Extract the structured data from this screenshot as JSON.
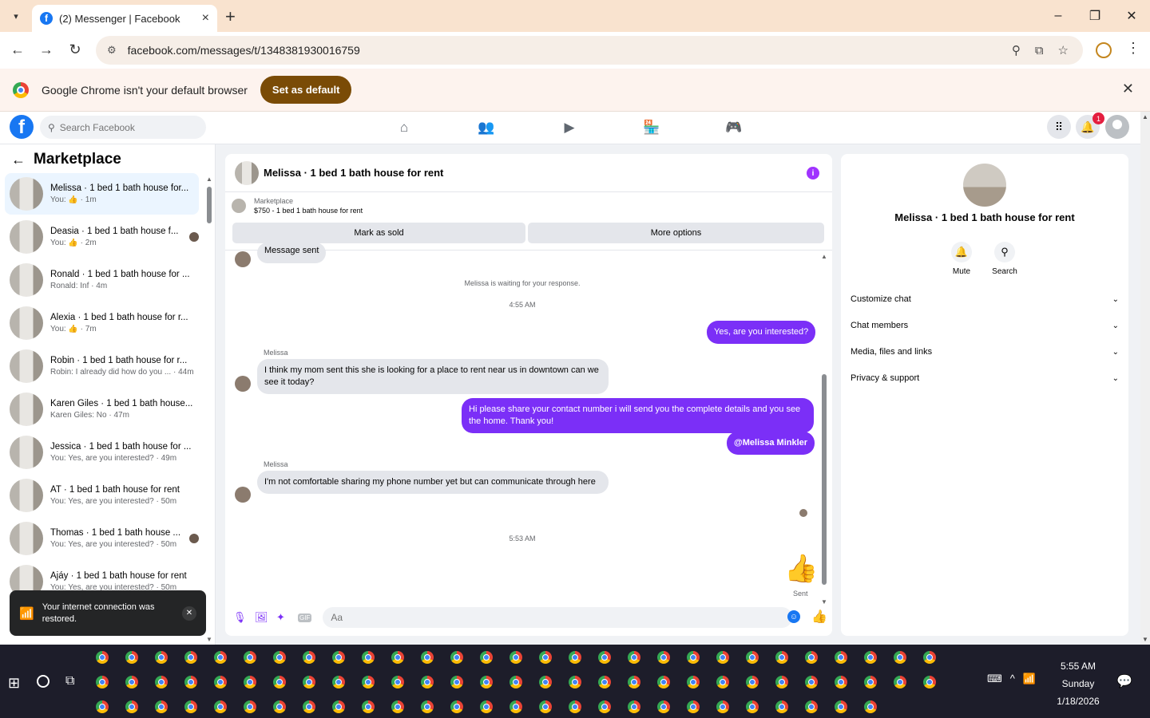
{
  "browser": {
    "tab_title": "(2) Messenger | Facebook",
    "url": "facebook.com/messages/t/1348381930016759",
    "infobar_message": "Google Chrome isn't your default browser",
    "infobar_button": "Set as default"
  },
  "fb": {
    "search_placeholder": "Search Facebook",
    "notification_count": "1"
  },
  "sidebar": {
    "title": "Marketplace",
    "conversations": [
      {
        "name": "Melissa · 1 bed 1 bath house for...",
        "sub": "You: 👍 · 1m",
        "active": true,
        "seen": false
      },
      {
        "name": "Deasia · 1 bed 1 bath house f...",
        "sub": "You: 👍 · 2m",
        "active": false,
        "seen": true
      },
      {
        "name": "Ronald · 1 bed 1 bath house for ...",
        "sub": "Ronald: Inf · 4m",
        "active": false,
        "seen": false
      },
      {
        "name": "Alexia · 1 bed 1 bath house for r...",
        "sub": "You: 👍 · 7m",
        "active": false,
        "seen": false
      },
      {
        "name": "Robin · 1 bed 1 bath house for r...",
        "sub": "Robin: I already did how do you ... · 44m",
        "active": false,
        "seen": false
      },
      {
        "name": "Karen Giles · 1 bed 1 bath house...",
        "sub": "Karen Giles: No · 47m",
        "active": false,
        "seen": false
      },
      {
        "name": "Jessica · 1 bed 1 bath house for ...",
        "sub": "You: Yes, are you interested? · 49m",
        "active": false,
        "seen": false
      },
      {
        "name": "AT · 1 bed 1 bath house for rent",
        "sub": "You: Yes, are you interested? · 50m",
        "active": false,
        "seen": false
      },
      {
        "name": "Thomas · 1 bed 1 bath house ...",
        "sub": "You: Yes, are you interested? · 50m",
        "active": false,
        "seen": true
      },
      {
        "name": "Ajáy · 1 bed 1 bath house for rent",
        "sub": "You: Yes, are you interested? · 50m",
        "active": false,
        "seen": false
      }
    ]
  },
  "toast": {
    "message": "Your internet connection was restored."
  },
  "chat": {
    "title": "Melissa · 1 bed 1 bath house for rent",
    "listing_source": "Marketplace",
    "listing_detail": "$750 - 1 bed 1 bath house for rent",
    "mark_sold": "Mark as sold",
    "more_options": "More options",
    "clipped_message": "Message sent",
    "waiting_notice": "Melissa is waiting for your response.",
    "time1": "4:55 AM",
    "out1": "Yes, are you interested?",
    "sender": "Melissa",
    "in1": "I think my mom sent this she is looking for a place to rent near us in downtown can we see it today?",
    "out2": "Hi please share your contact number i will send you the complete details and you see the home. Thank you!",
    "out3": "@Melissa Minkler",
    "in2": "I'm not comfortable sharing my phone number yet but can communicate through here",
    "time2": "5:53 AM",
    "sent_label": "Sent",
    "input_placeholder": "Aa",
    "gif_label": "GIF"
  },
  "right_panel": {
    "name": "Melissa · 1 bed 1 bath house for rent",
    "mute": "Mute",
    "search": "Search",
    "sections": [
      "Customize chat",
      "Chat members",
      "Media, files and links",
      "Privacy & support"
    ]
  },
  "taskbar": {
    "time": "5:55 AM",
    "day": "Sunday",
    "date": "1/18/2026"
  },
  "colors": {
    "fb_blue": "#1877f2",
    "messenger_purple": "#7b2ff7",
    "infobar_button": "#7a4b06"
  }
}
